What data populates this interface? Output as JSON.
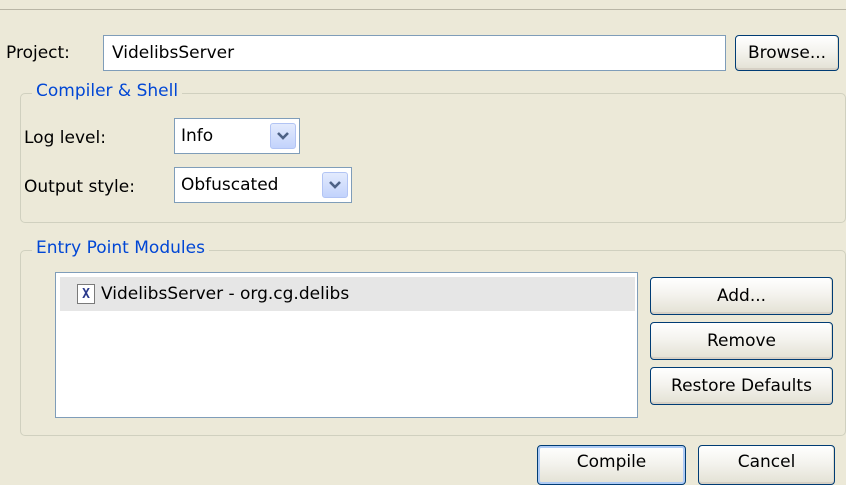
{
  "project": {
    "label": "Project:",
    "value": "VidelibsServer",
    "browse_label": "Browse..."
  },
  "compiler_shell": {
    "title": "Compiler & Shell",
    "log_level": {
      "label": "Log level:",
      "value": "Info"
    },
    "output_style": {
      "label": "Output style:",
      "value": "Obfuscated"
    }
  },
  "entry_point_modules": {
    "title": "Entry Point Modules",
    "items": [
      {
        "label": "VidelibsServer - org.cg.delibs",
        "icon": "gwt-module-icon",
        "icon_glyph": "X"
      }
    ],
    "add_label": "Add...",
    "remove_label": "Remove",
    "restore_label": "Restore Defaults"
  },
  "footer": {
    "compile_label": "Compile",
    "cancel_label": "Cancel"
  }
}
